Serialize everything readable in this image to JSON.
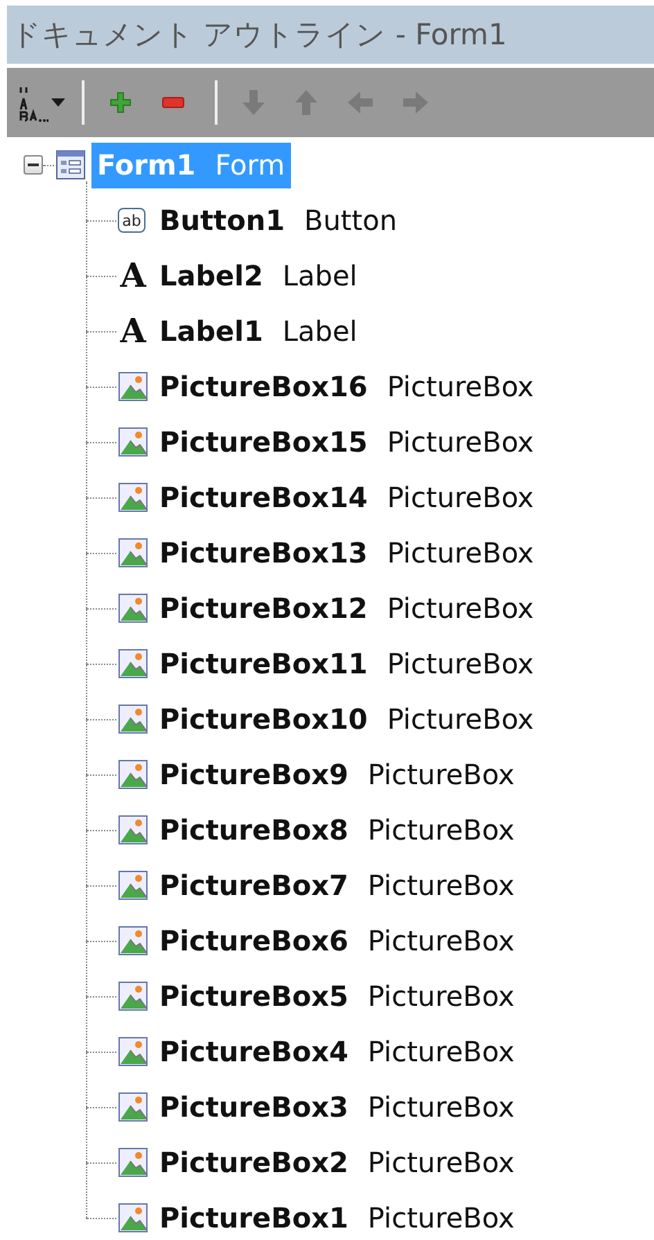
{
  "window": {
    "title": "ドキュメント アウトライン - Form1"
  },
  "toolbar": [
    {
      "buttons": [
        {
          "kind": "sort",
          "disabled": false
        },
        {
          "kind": "dropdown",
          "disabled": false
        }
      ]
    },
    {
      "buttons": [
        {
          "kind": "add",
          "disabled": false
        },
        {
          "kind": "remove",
          "disabled": false
        }
      ]
    },
    {
      "buttons": [
        {
          "kind": "down",
          "disabled": true
        },
        {
          "kind": "up",
          "disabled": true
        },
        {
          "kind": "left",
          "disabled": true
        },
        {
          "kind": "right",
          "disabled": true
        }
      ]
    }
  ],
  "tree": [
    {
      "name": "Form1",
      "type": "Form",
      "kind": "form",
      "selected": true,
      "expanded": true,
      "children": [
        {
          "name": "Button1",
          "type": "Button",
          "kind": "button",
          "icon_text": "ab",
          "selected": false
        },
        {
          "name": "Label2",
          "type": "Label",
          "kind": "label",
          "icon_text": "A",
          "selected": false
        },
        {
          "name": "Label1",
          "type": "Label",
          "kind": "label",
          "icon_text": "A",
          "selected": false
        },
        {
          "name": "PictureBox16",
          "type": "PictureBox",
          "kind": "picturebox",
          "selected": false
        },
        {
          "name": "PictureBox15",
          "type": "PictureBox",
          "kind": "picturebox",
          "selected": false
        },
        {
          "name": "PictureBox14",
          "type": "PictureBox",
          "kind": "picturebox",
          "selected": false
        },
        {
          "name": "PictureBox13",
          "type": "PictureBox",
          "kind": "picturebox",
          "selected": false
        },
        {
          "name": "PictureBox12",
          "type": "PictureBox",
          "kind": "picturebox",
          "selected": false
        },
        {
          "name": "PictureBox11",
          "type": "PictureBox",
          "kind": "picturebox",
          "selected": false
        },
        {
          "name": "PictureBox10",
          "type": "PictureBox",
          "kind": "picturebox",
          "selected": false
        },
        {
          "name": "PictureBox9",
          "type": "PictureBox",
          "kind": "picturebox",
          "selected": false
        },
        {
          "name": "PictureBox8",
          "type": "PictureBox",
          "kind": "picturebox",
          "selected": false
        },
        {
          "name": "PictureBox7",
          "type": "PictureBox",
          "kind": "picturebox",
          "selected": false
        },
        {
          "name": "PictureBox6",
          "type": "PictureBox",
          "kind": "picturebox",
          "selected": false
        },
        {
          "name": "PictureBox5",
          "type": "PictureBox",
          "kind": "picturebox",
          "selected": false
        },
        {
          "name": "PictureBox4",
          "type": "PictureBox",
          "kind": "picturebox",
          "selected": false
        },
        {
          "name": "PictureBox3",
          "type": "PictureBox",
          "kind": "picturebox",
          "selected": false
        },
        {
          "name": "PictureBox2",
          "type": "PictureBox",
          "kind": "picturebox",
          "selected": false
        },
        {
          "name": "PictureBox1",
          "type": "PictureBox",
          "kind": "picturebox",
          "selected": false
        }
      ]
    }
  ]
}
